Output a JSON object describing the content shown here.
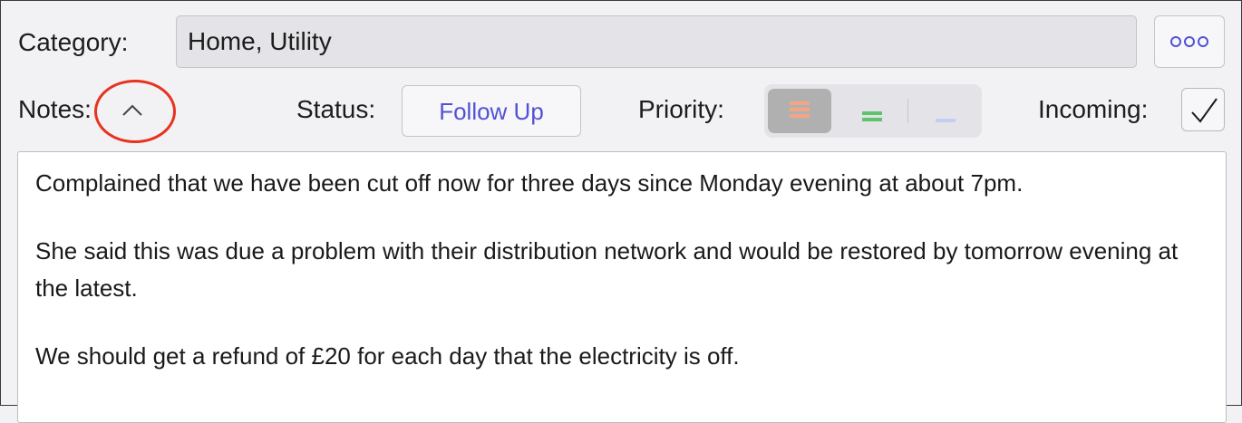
{
  "category": {
    "label": "Category:",
    "value": "Home, Utility",
    "more_icon": "ellipsis-icon"
  },
  "notes": {
    "label": "Notes:",
    "toggle_icon": "chevron-up-icon"
  },
  "status": {
    "label": "Status:",
    "value": "Follow Up"
  },
  "priority": {
    "label": "Priority:",
    "options": [
      {
        "name": "high",
        "icon": "three-bars-icon",
        "color": "#f4a583",
        "selected": true
      },
      {
        "name": "medium",
        "icon": "two-bars-icon",
        "color": "#5ec46e",
        "selected": false
      },
      {
        "name": "low",
        "icon": "one-bar-icon",
        "color": "#c5cdf5",
        "selected": false
      }
    ]
  },
  "incoming": {
    "label": "Incoming:",
    "checked": true
  },
  "note_text": {
    "paragraph_1": "Complained that we have been cut off now for three days since Monday evening at about 7pm.",
    "paragraph_2": "She said this was due a problem with their distribution network and would be restored by tomorrow evening at the latest.",
    "paragraph_3": "We should get a refund of £20 for each day that the electricity is off."
  },
  "colors": {
    "accent": "#5151d6",
    "annotation": "#e8321f"
  }
}
